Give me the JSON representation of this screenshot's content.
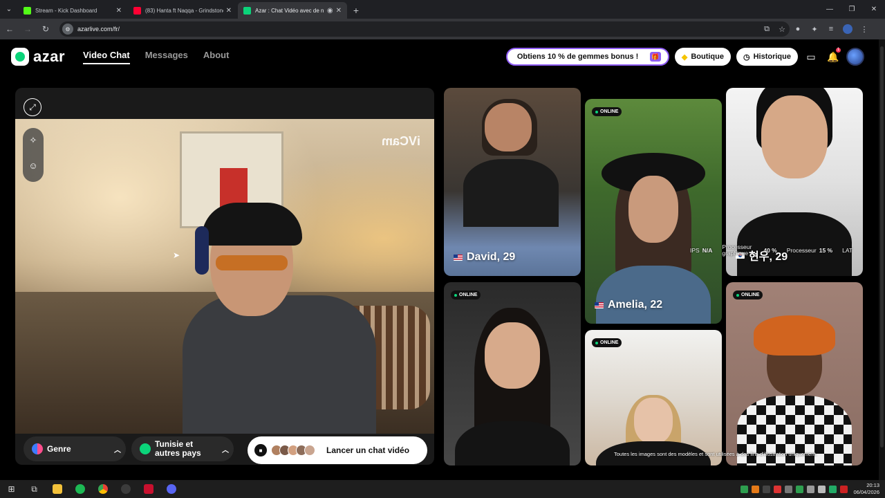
{
  "browser": {
    "tabs": [
      {
        "title": "Stream - Kick Dashboard",
        "color": "#53fc18"
      },
      {
        "title": "(83) Hanta ft Naqqa - Grindstone",
        "color": "#ff0033"
      },
      {
        "title": "Azar : Chat Vidéo avec de n",
        "color": "#0bd47a"
      }
    ],
    "url": "azarlive.com/fr/"
  },
  "nav": {
    "logo": "azar",
    "links": [
      "Video Chat",
      "Messages",
      "About"
    ],
    "promo": "Obtiens 10 % de gemmes bonus !",
    "shop": "Boutique",
    "history": "Historique",
    "notif_count": "1"
  },
  "video": {
    "watermark": "iVCam",
    "gender_label": "Genre",
    "country_label": "Tunisie et autres pays",
    "launch_label": "Lancer un chat vidéo"
  },
  "gallery": {
    "online_label": "ONLINE",
    "profiles": [
      {
        "name": "David, 29",
        "flag": "us"
      },
      {
        "name": "Amelia, 22",
        "flag": "us"
      },
      {
        "name": "현우, 29",
        "flag": "kr"
      }
    ],
    "disclaimer": "Toutes les images sont des modèles et sont utilisées à des fins d'illustration uniquement."
  },
  "stats": {
    "ips_label": "IPS",
    "ips_value": "N/A",
    "gpu_label": "Processeur graphique",
    "gpu_value": "40 %",
    "cpu_label": "Processeur",
    "cpu_value": "15 %",
    "lat_label": "LAT"
  },
  "taskbar": {
    "time": "20:13",
    "date": "06/04/2026"
  }
}
